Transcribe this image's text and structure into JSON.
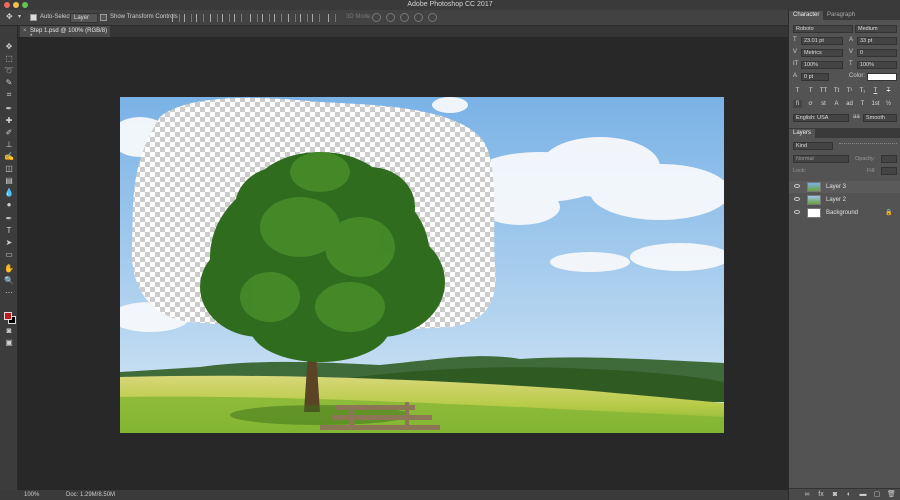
{
  "window": {
    "title": "Adobe Photoshop CC 2017"
  },
  "options_bar": {
    "auto_select_label": "Auto-Select:",
    "auto_select_value": "Layer",
    "show_transform_label": "Show Transform Controls",
    "mode_3d_label": "3D Mode:"
  },
  "document": {
    "tab_label": "Step 1.psd @ 100% (RGB/8) *"
  },
  "status": {
    "zoom": "100%",
    "doc_info": "Doc: 1.29M/8.50M"
  },
  "character_panel": {
    "tabs": [
      "Character",
      "Paragraph"
    ],
    "font_family": "Roboto",
    "font_style": "Medium",
    "font_size": "23.01 pt",
    "leading": "33 pt",
    "kerning": "Metrics",
    "tracking": "0",
    "vertical_scale": "100%",
    "horizontal_scale": "100%",
    "baseline_shift": "0 pt",
    "color_label": "Color:",
    "type_buttons": [
      "T",
      "T",
      "TT",
      "Tt",
      "T¹",
      "T₁",
      "T",
      "T"
    ],
    "ot_buttons": [
      "fi",
      "ơ",
      "st",
      "A",
      "ad",
      "T",
      "1st",
      "½"
    ],
    "language": "English: USA",
    "aa_label": "aa",
    "antialias": "Smooth"
  },
  "layers_panel": {
    "tab": "Layers",
    "filter_kind": "Kind",
    "blend_mode": "Normal",
    "opacity_label": "Opacity:",
    "lock_label": "Lock:",
    "fill_label": "Fill:",
    "layers": [
      {
        "name": "Layer 3"
      },
      {
        "name": "Layer 2"
      },
      {
        "name": "Background"
      }
    ]
  },
  "colors": {
    "foreground": "#c11b1b",
    "background": "#000000",
    "accent": "#2d6fd6"
  }
}
